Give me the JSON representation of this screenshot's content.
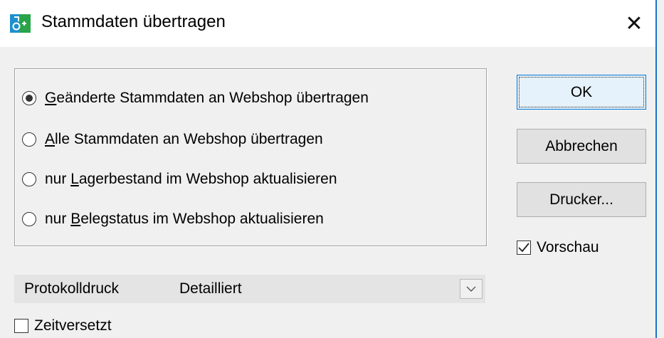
{
  "window": {
    "title": "Stammdaten übertragen",
    "close_glyph": "✕",
    "accent": "#0078d7"
  },
  "options": {
    "items": [
      {
        "prefix": "",
        "mnemonic": "G",
        "rest": "eänderte Stammdaten an Webshop übertragen",
        "checked": true
      },
      {
        "prefix": "",
        "mnemonic": "A",
        "rest": "lle Stammdaten an Webshop übertragen",
        "checked": false
      },
      {
        "prefix": "nur ",
        "mnemonic": "L",
        "rest": "agerbestand im Webshop aktualisieren",
        "checked": false
      },
      {
        "prefix": "nur ",
        "mnemonic": "B",
        "rest": "elegstatus im Webshop aktualisieren",
        "checked": false
      }
    ]
  },
  "buttons": {
    "ok": "OK",
    "cancel": "Abbrechen",
    "printer": "Drucker..."
  },
  "preview": {
    "label": "Vorschau",
    "checked": true
  },
  "protocol": {
    "label": "Protokolldruck",
    "value": "Detailliert"
  },
  "delayed": {
    "label": "Zeitversetzt",
    "checked": false
  }
}
